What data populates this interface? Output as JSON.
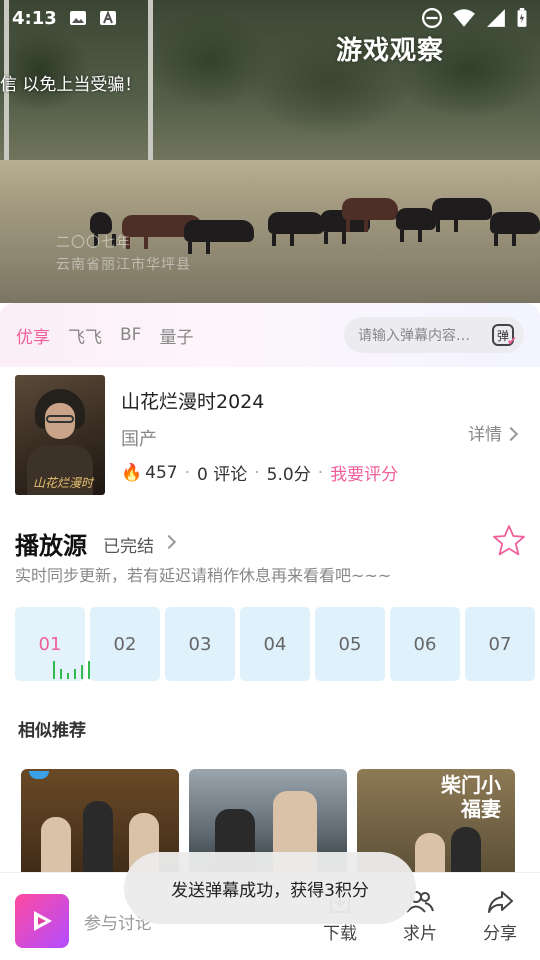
{
  "status_bar": {
    "time": "4:13"
  },
  "video": {
    "watermark": "游戏观察",
    "danmu_text": "信 以免上当受骗！",
    "caption_line1": "二〇〇七年",
    "caption_line2": "云南省丽江市华坪县"
  },
  "source_tabs": [
    "优享",
    "飞飞",
    "BF",
    "量子"
  ],
  "danmu_input": {
    "placeholder": "请输入弹幕内容…",
    "button_label": "弹"
  },
  "show": {
    "poster_title": "山花烂漫时",
    "title": "山花烂漫时2024",
    "region": "国产",
    "details_label": "详情",
    "heat": "457",
    "comments": "0 评论",
    "score": "5.0分",
    "rate_label": "我要评分"
  },
  "play_source": {
    "title": "播放源",
    "status": "已完结",
    "note": "实时同步更新，若有延迟请稍作休息再来看看吧~~~",
    "episodes": [
      "01",
      "02",
      "03",
      "04",
      "05",
      "06",
      "07"
    ]
  },
  "recommend": {
    "title": "相似推荐",
    "item3_title": "柴门小福妻"
  },
  "toast": "发送弹幕成功，获得3积分",
  "bottom_bar": {
    "discuss_placeholder": "参与讨论",
    "download": "下载",
    "request": "求片",
    "share": "分享"
  },
  "colors": {
    "accent": "#f0609a",
    "episode_bg": "#dff1fb",
    "playing_bars": "#2fbb4f"
  }
}
